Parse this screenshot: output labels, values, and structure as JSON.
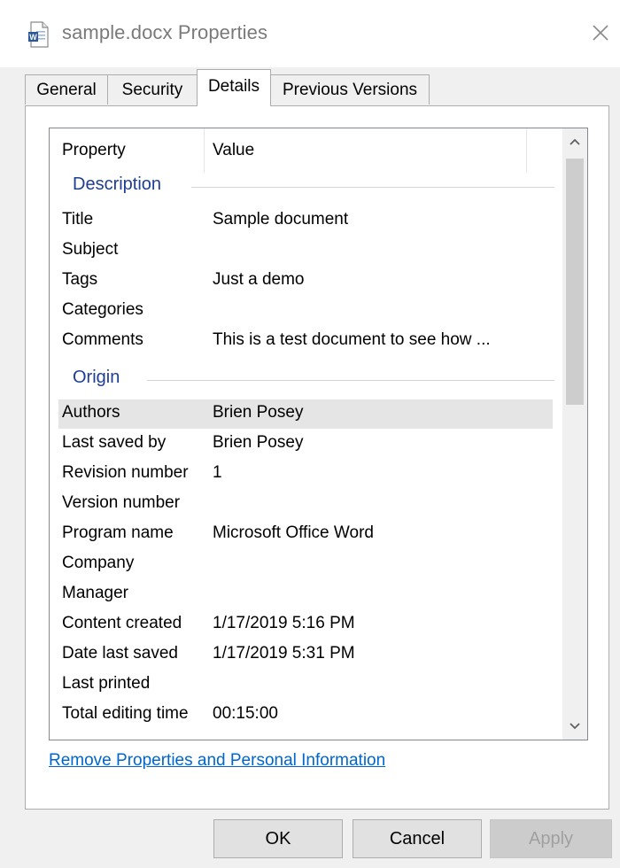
{
  "window": {
    "title": "sample.docx Properties",
    "icon": "word-document-icon"
  },
  "tabs": [
    {
      "label": "General",
      "active": false
    },
    {
      "label": "Security",
      "active": false
    },
    {
      "label": "Details",
      "active": true
    },
    {
      "label": "Previous Versions",
      "active": false
    }
  ],
  "list": {
    "columns": {
      "property": "Property",
      "value": "Value"
    },
    "groups": [
      {
        "label": "Description",
        "rows": [
          {
            "property": "Title",
            "value": "Sample document"
          },
          {
            "property": "Subject",
            "value": ""
          },
          {
            "property": "Tags",
            "value": "Just a demo"
          },
          {
            "property": "Categories",
            "value": ""
          },
          {
            "property": "Comments",
            "value": "This is a test document to see how ..."
          }
        ]
      },
      {
        "label": "Origin",
        "rows": [
          {
            "property": "Authors",
            "value": "Brien Posey",
            "selected": true
          },
          {
            "property": "Last saved by",
            "value": "Brien Posey"
          },
          {
            "property": "Revision number",
            "value": "1"
          },
          {
            "property": "Version number",
            "value": ""
          },
          {
            "property": "Program name",
            "value": "Microsoft Office Word"
          },
          {
            "property": "Company",
            "value": ""
          },
          {
            "property": "Manager",
            "value": ""
          },
          {
            "property": "Content created",
            "value": "1/17/2019 5:16 PM"
          },
          {
            "property": "Date last saved",
            "value": "1/17/2019 5:31 PM"
          },
          {
            "property": "Last printed",
            "value": ""
          },
          {
            "property": "Total editing time",
            "value": "00:15:00"
          }
        ]
      }
    ]
  },
  "link": "Remove Properties and Personal Information",
  "buttons": {
    "ok": "OK",
    "cancel": "Cancel",
    "apply": "Apply"
  },
  "colors": {
    "group_heading": "#1e3d94",
    "link": "#0066cc",
    "selected_row": "#e5e5e5"
  }
}
